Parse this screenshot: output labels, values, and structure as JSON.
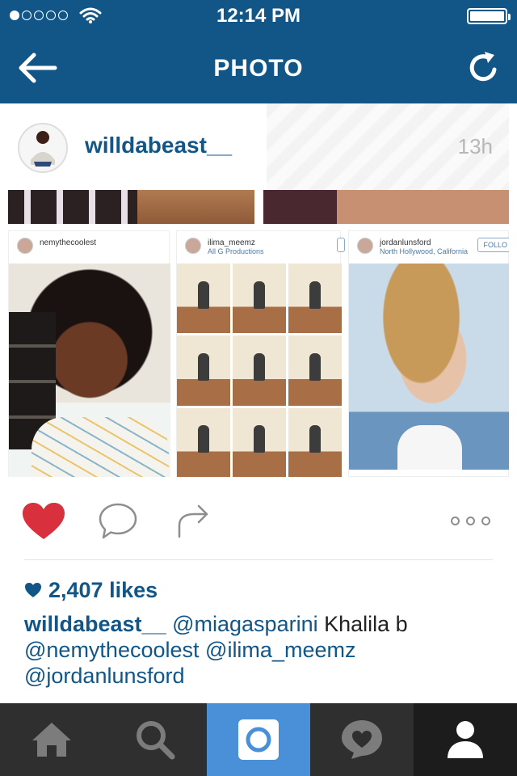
{
  "status_bar": {
    "time": "12:14 PM",
    "signal_filled": 1,
    "signal_total": 5,
    "battery_level": 1.0
  },
  "nav": {
    "title": "PHOTO",
    "back_icon": "back-arrow-icon",
    "refresh_icon": "refresh-icon"
  },
  "post": {
    "username": "willdabeast__",
    "timestamp": "13h",
    "collage": {
      "panels": [
        {
          "username": "nemythecoolest",
          "subtitle": ""
        },
        {
          "username": "ilima_meemz",
          "subtitle": "All G Productions"
        },
        {
          "username": "jordanlunsford",
          "subtitle": "North Hollywood, California",
          "follow_label": "FOLLO"
        }
      ]
    },
    "likes": "2,407 likes",
    "liked": true,
    "caption": {
      "user": "willdabeast__",
      "mention_1": "@miagasparini",
      "text": " Khalila b ",
      "mention_2": "@nemythecoolest",
      "mention_3": "@ilima_meemz",
      "mention_4": "@jordanlunsford"
    }
  },
  "tabbar": {
    "tabs": [
      {
        "icon": "home-icon"
      },
      {
        "icon": "search-icon"
      },
      {
        "icon": "camera-icon",
        "active": true
      },
      {
        "icon": "activity-heart-icon"
      },
      {
        "icon": "profile-icon"
      }
    ]
  },
  "colors": {
    "brand": "#125688",
    "like_red": "#d8303c",
    "tab_active": "#4a90d9"
  }
}
